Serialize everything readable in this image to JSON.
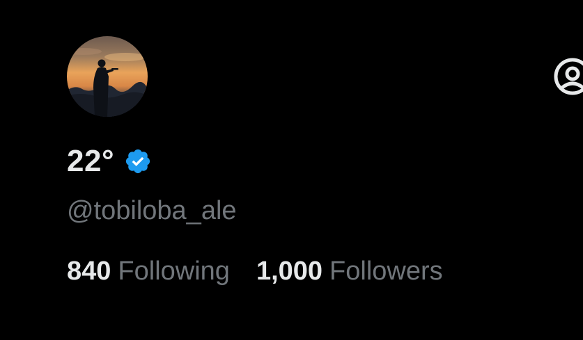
{
  "profile": {
    "display_name": "22°",
    "handle": "@tobiloba_ale",
    "verified": true,
    "avatar_icon": "avatar-silhouette-sunset"
  },
  "stats": [
    {
      "count": "840",
      "label": "Following"
    },
    {
      "count": "1,000",
      "label": "Followers"
    }
  ],
  "header": {
    "account_switch_icon": "account-switch-icon"
  },
  "colors": {
    "background": "#000000",
    "primary_text": "#e7e9ea",
    "secondary_text": "#71767b",
    "verified_badge": "#1d9bf0"
  }
}
